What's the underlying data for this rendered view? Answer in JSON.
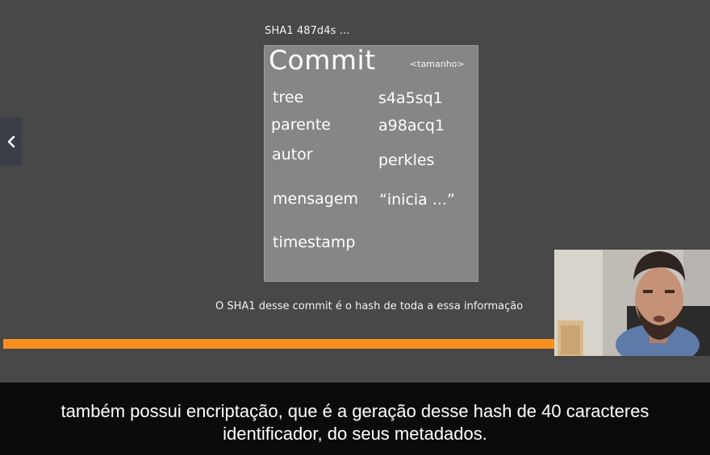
{
  "slide": {
    "sha_label": "SHA1 487d4s ...",
    "commit_title": "Commit",
    "commit_size": "<tamanho>",
    "fields": [
      {
        "label": "tree",
        "value": "s4a5sq1"
      },
      {
        "label": "parente",
        "value": "a98acq1"
      },
      {
        "label": "autor",
        "value": "perkles"
      },
      {
        "label": "mensagem",
        "value": "“inicia ...”"
      },
      {
        "label": "timestamp",
        "value": ""
      }
    ],
    "explanation": "O SHA1 desse commit é o hash de toda a essa informação"
  },
  "navigation": {
    "back_icon": "chevron-left-icon"
  },
  "progress": {
    "fraction": 0.78,
    "color": "#f7901e"
  },
  "subtitles": {
    "line1": "também possui encriptação, que é a geração desse hash de 40 caracteres",
    "line2": "identificador, do seus metadados."
  }
}
